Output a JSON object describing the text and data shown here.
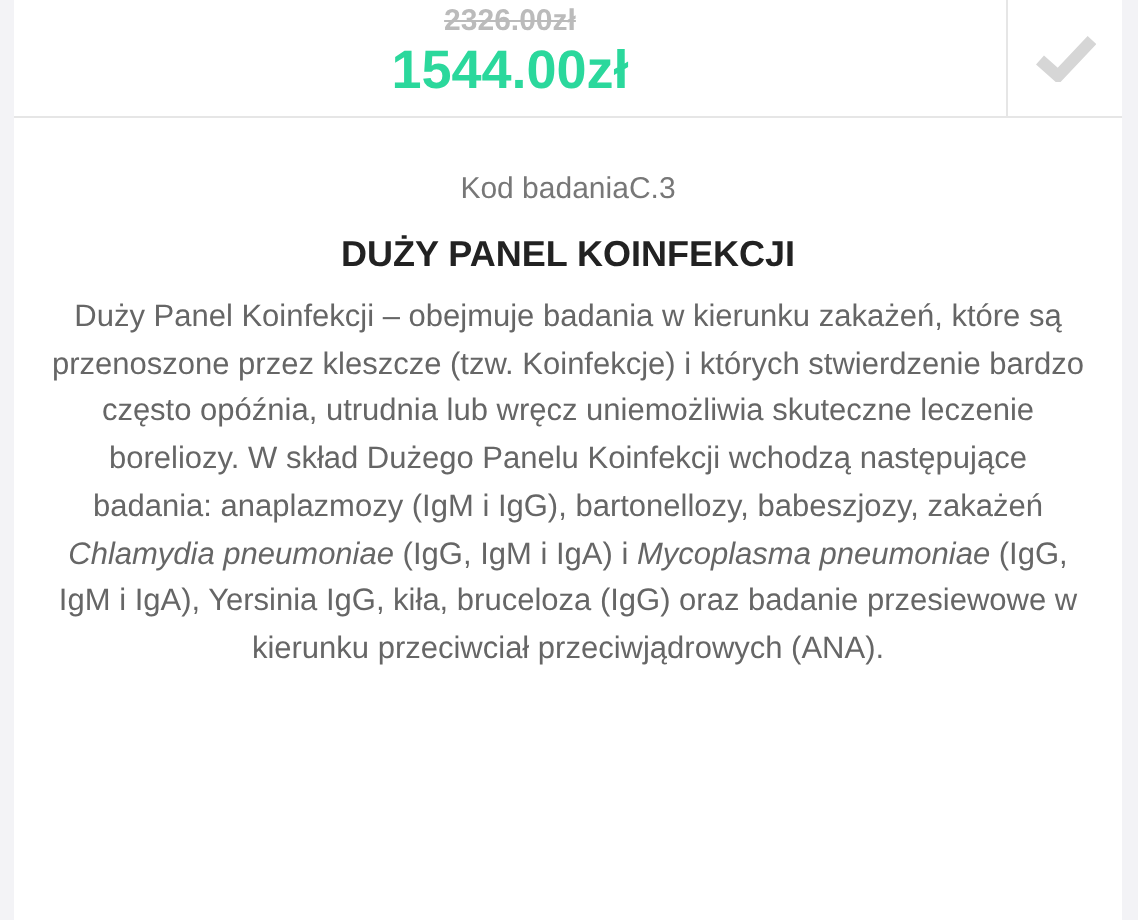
{
  "price": {
    "old": "2326.00zł",
    "current": "1544.00zł"
  },
  "select_button": {
    "selected": false
  },
  "code": "Kod badaniaC.3",
  "title": "DUŻY PANEL KOINFEKCJI",
  "description": "Duży Panel Koinfekcji – obejmuje badania w kierunku zakażeń, które są przenoszone przez kleszcze (tzw. Koinfekcje) i których stwierdzenie bardzo często opóźnia, utrudnia lub wręcz uniemożliwia skuteczne leczenie boreliozy. W skład Dużego Panelu Koinfekcji wchodzą następujące badania: anaplazmozy (IgM i IgG), bartonellozy, babeszjozy, zakażeń *Chlamydia pneumoniae* (IgG, IgM i IgA) i *Mycoplasma pneumoniae* (IgG, IgM i IgA), Yersinia IgG, kiła, bruceloza (IgG) oraz badanie przesiewowe w kierunku przeciwciał przeciwjądrowych (ANA)."
}
